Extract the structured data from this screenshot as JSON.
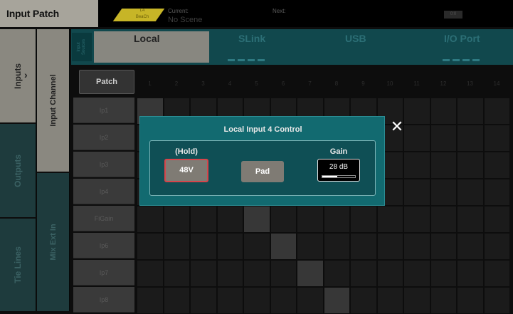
{
  "header": {
    "title": "Input Patch",
    "scene_badge": "L4\nBeaCh",
    "current_label": "Current:",
    "current_value": "No Scene",
    "next_label": "Next:",
    "status_box": "0:0"
  },
  "left_tabs": {
    "inputs": "Inputs",
    "outputs": "Outputs",
    "tie_lines": "Tie Lines",
    "input_channel": "Input Channel",
    "mix_ext_in": "Mix Ext In"
  },
  "sources": {
    "label": "Input\nSources",
    "local": "Local",
    "slink": "SLink",
    "usb": "USB",
    "io_port": "I/O Port"
  },
  "grid": {
    "patch_label": "Patch",
    "columns": [
      "1",
      "2",
      "3",
      "4",
      "5",
      "6",
      "7",
      "8",
      "9",
      "10",
      "11",
      "12",
      "13",
      "14"
    ],
    "rows": [
      "Ip1",
      "Ip2",
      "Ip3",
      "Ip4",
      "FiGain",
      "Ip6",
      "Ip7",
      "Ip8"
    ],
    "patched_column_per_row": [
      1,
      2,
      3,
      4,
      5,
      6,
      7,
      8
    ]
  },
  "dialog": {
    "title": "Local Input 4 Control",
    "hold_label": "(Hold)",
    "phantom_button": "48V",
    "pad_button": "Pad",
    "gain_label": "Gain",
    "gain_value": "28 dB",
    "gain_fraction": 0.45,
    "close_icon": "close-icon"
  },
  "colors": {
    "dialog_bg": "#126a70",
    "phantom_border": "#d6454b",
    "title_bg": "#a7a49b",
    "badge": "#c7b527"
  }
}
